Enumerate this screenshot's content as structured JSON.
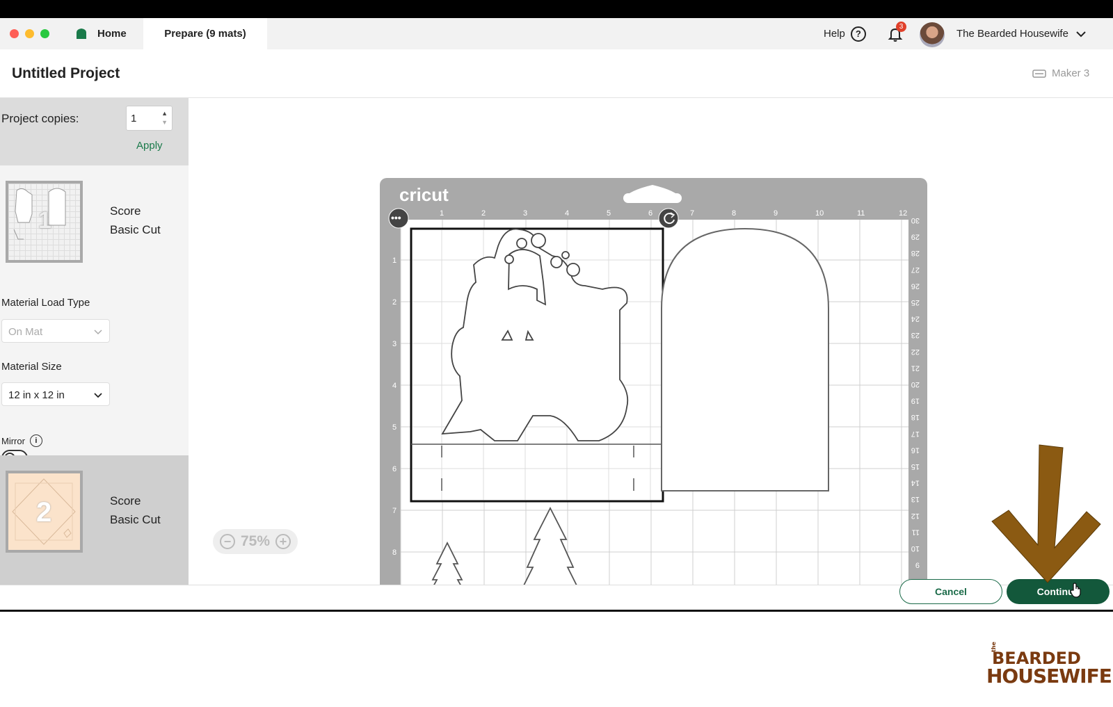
{
  "window": {
    "tabs": [
      {
        "label": "Home"
      },
      {
        "label": "Prepare (9 mats)"
      }
    ],
    "help_label": "Help",
    "notification_count": "3",
    "user_name": "The Bearded Housewife"
  },
  "project": {
    "title": "Untitled Project",
    "machine": "Maker 3"
  },
  "sidebar": {
    "copies_label": "Project copies:",
    "copies_value": "1",
    "apply_label": "Apply",
    "mats": [
      {
        "number": "1",
        "line1": "Score",
        "line2": "Basic Cut"
      },
      {
        "number": "2",
        "line1": "Score",
        "line2": "Basic Cut"
      }
    ],
    "material_load_type_label": "Material Load Type",
    "material_load_type_value": "On Mat",
    "material_size_label": "Material Size",
    "material_size_value": "12 in x 12 in",
    "mirror_label": "Mirror",
    "mirror_on": false
  },
  "canvas": {
    "brand": "cricut",
    "top_ruler": [
      "1",
      "2",
      "3",
      "4",
      "5",
      "6",
      "7",
      "8",
      "9",
      "10",
      "11",
      "12"
    ],
    "left_ruler": [
      "1",
      "2",
      "3",
      "4",
      "5",
      "6",
      "7",
      "8"
    ],
    "right_ruler": [
      "30",
      "29",
      "28",
      "27",
      "26",
      "25",
      "24",
      "23",
      "22",
      "21",
      "20",
      "19",
      "18",
      "17",
      "16",
      "15",
      "14",
      "13",
      "12",
      "11",
      "10",
      "9"
    ],
    "zoom_level": "75%"
  },
  "footer": {
    "cancel_label": "Cancel",
    "continue_label": "Continue"
  },
  "watermark": {
    "small": "the",
    "line1": "BEARDED",
    "line2": "HOUSEWIFE"
  },
  "colors": {
    "accent_green": "#13583b",
    "apply_green": "#1a7a4a",
    "badge_red": "#e0402a",
    "arrow_brown": "#8b5a12",
    "mat_gray": "#a9a9a9"
  }
}
